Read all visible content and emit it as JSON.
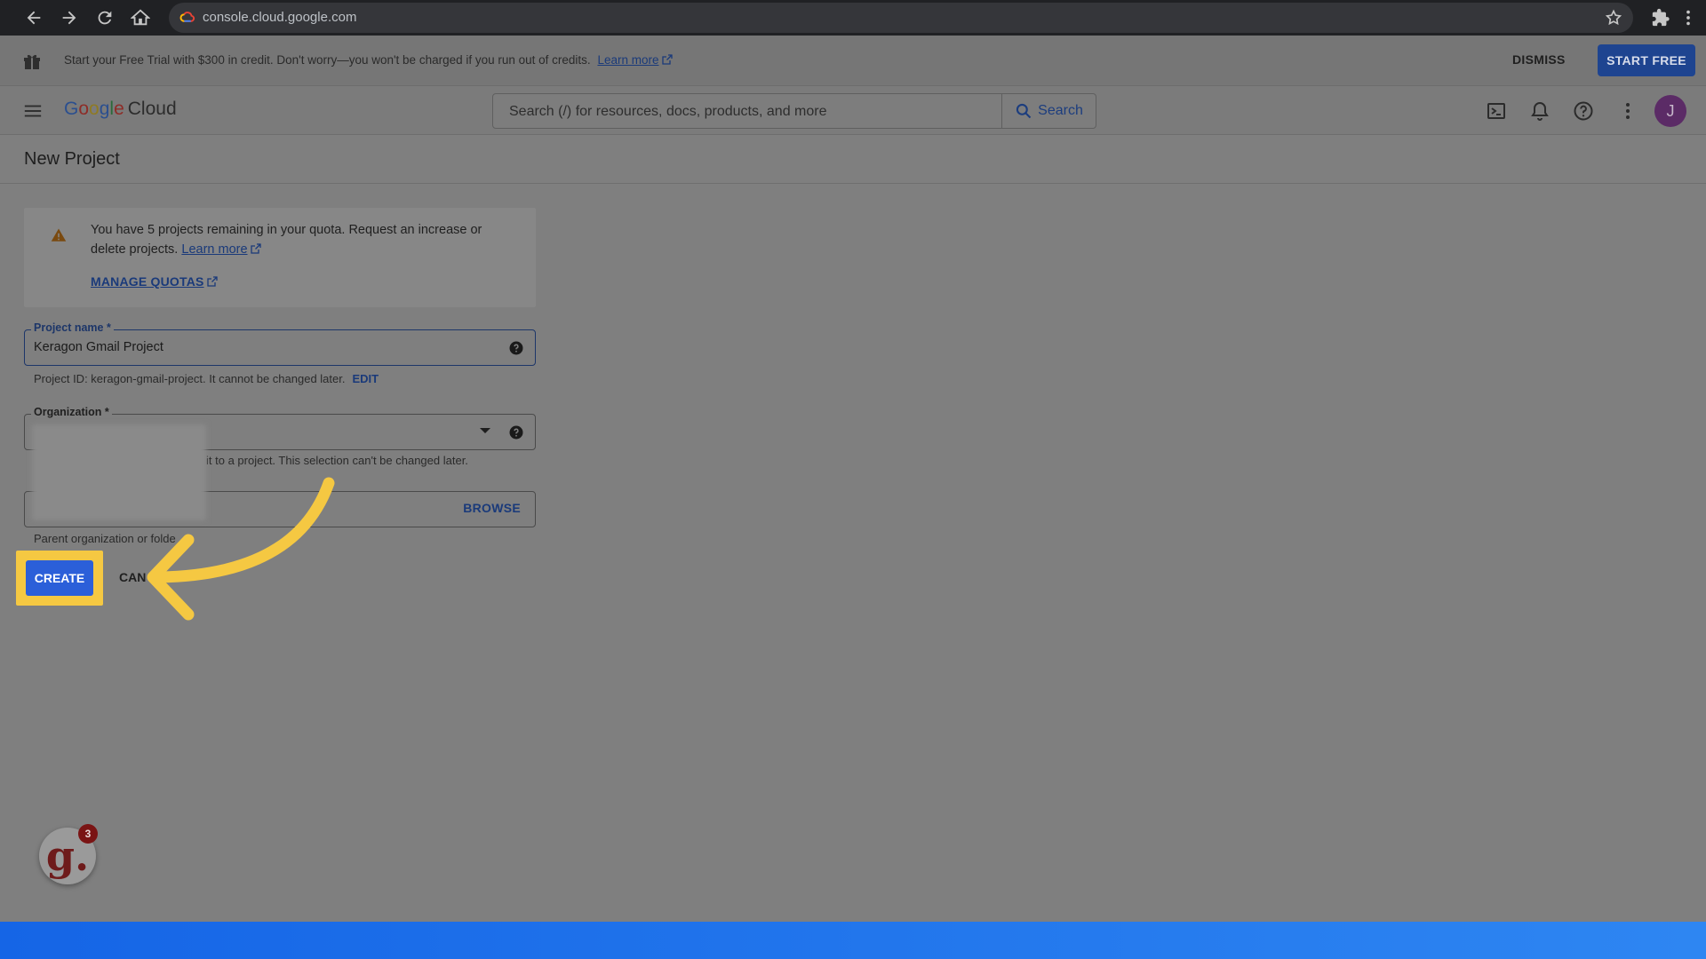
{
  "browser": {
    "url": "console.cloud.google.com"
  },
  "trial_banner": {
    "text": "Start your Free Trial with $300 in credit. Don't worry—you won't be charged if you run out of credits.",
    "learn_more": "Learn more",
    "dismiss": "DISMISS",
    "start_free": "START FREE"
  },
  "header": {
    "logo_letters": [
      "G",
      "o",
      "o",
      "g",
      "l",
      "e"
    ],
    "logo_product": "Cloud",
    "search_placeholder": "Search (/) for resources, docs, products, and more",
    "search_button": "Search",
    "avatar_initial": "J"
  },
  "page": {
    "title": "New Project"
  },
  "quota_notice": {
    "text": "You have 5 projects remaining in your quota. Request an increase or delete projects.",
    "learn_more": "Learn more",
    "manage_quotas": "MANAGE QUOTAS"
  },
  "form": {
    "project_name_label": "Project name *",
    "project_name_value": "Keragon Gmail Project",
    "project_id_hint": "Project ID: keragon-gmail-project. It cannot be changed later.",
    "edit": "EDIT",
    "organization_label": "Organization *",
    "organization_hint_visible": "it to a project. This selection can't be changed later.",
    "browse": "BROWSE",
    "location_hint": "Parent organization or folde",
    "create": "CREATE",
    "cancel": "CAN"
  },
  "badge": {
    "letter": "g.",
    "count": "3"
  },
  "colors": {
    "create_button": "#2b5fd9",
    "highlight": "#f5c842",
    "bottom_bar": "#1565e6"
  }
}
